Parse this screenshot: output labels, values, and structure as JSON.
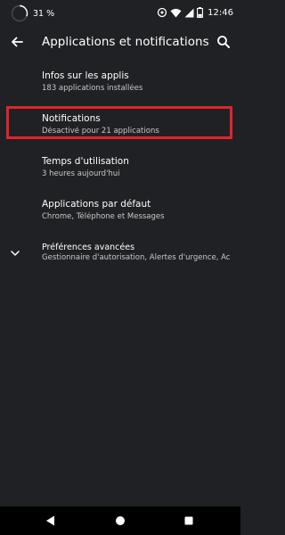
{
  "status_bar": {
    "battery_percent": "31 %",
    "battery_level": 0.31,
    "time": "12:46"
  },
  "app_bar": {
    "title": "Applications et notifications"
  },
  "items": [
    {
      "title": "Infos sur les applis",
      "subtitle": "183 applications installées"
    },
    {
      "title": "Notifications",
      "subtitle": "Désactivé pour 21 applications"
    },
    {
      "title": "Temps d'utilisation",
      "subtitle": "3 heures aujourd'hui"
    },
    {
      "title": "Applications par défaut",
      "subtitle": "Chrome, Téléphone et Messages"
    },
    {
      "title": "Préférences avancées",
      "subtitle": "Gestionnaire d'autorisation, Alertes d'urgence, Acc.."
    }
  ],
  "colors": {
    "background": "#202124",
    "highlight": "#e0242e",
    "nav_bar": "#000000"
  },
  "icons": {
    "back": "arrow-left",
    "search": "magnifier",
    "expand": "chevron-down",
    "nav_back": "triangle-left",
    "nav_home": "circle",
    "nav_recents": "square"
  }
}
